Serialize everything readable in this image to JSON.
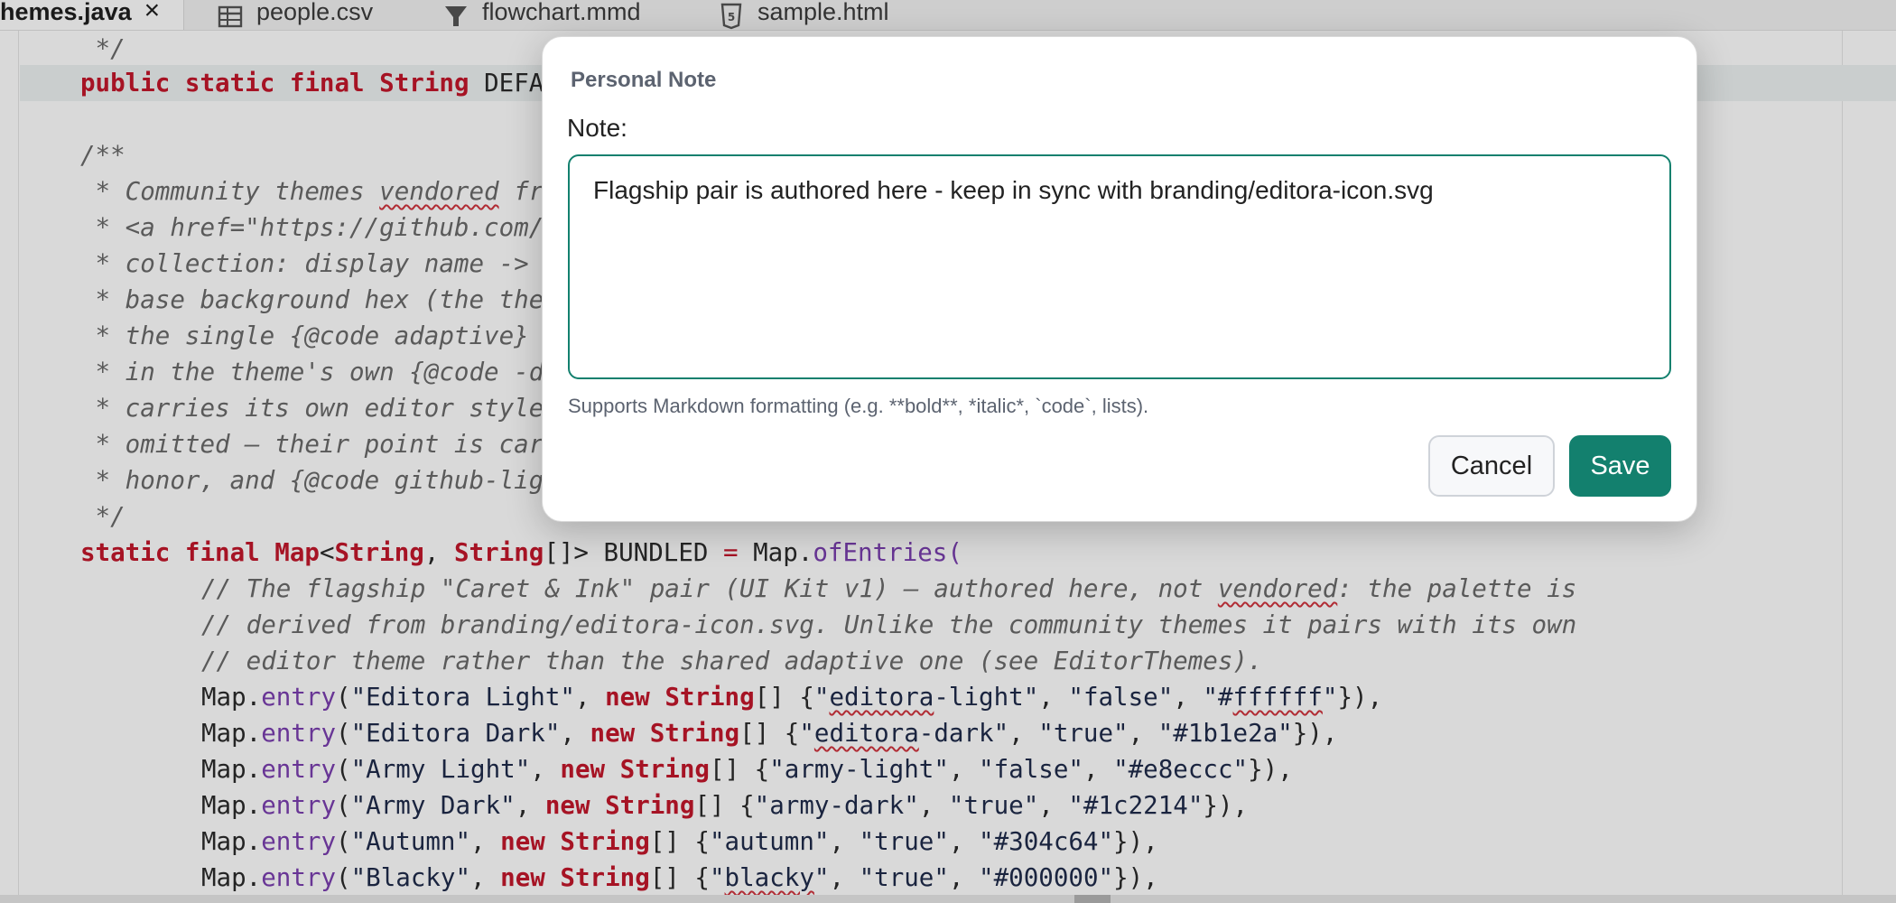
{
  "tabs": [
    {
      "label": "hemes.java",
      "close": "×",
      "active": true,
      "icon": ""
    },
    {
      "label": "people.csv",
      "active": false,
      "icon": "table-icon"
    },
    {
      "label": "flowchart.mmd",
      "active": false,
      "icon": "flowchart-icon"
    },
    {
      "label": "sample.html",
      "active": false,
      "icon": "html5-icon"
    }
  ],
  "code": {
    "line1": " */",
    "line2_a": "public",
    "line2_b": "static",
    "line2_c": "final",
    "line2_d": "String",
    "line2_e": "DEFA",
    "line4": "/**",
    "line5_a": " * Community themes ",
    "line5_b": "vendored",
    "line5_c": " fr",
    "line6": " * <a href=\"https://github.com/",
    "line7": " * collection: display name -> ",
    "line8": " * base background hex (the the",
    "line9": " * the single {@code adaptive} ",
    "line10": " * in the theme's own {@code -d",
    "line11": " * carries its own editor style",
    "line12": " * omitted — their point is car",
    "line13": " * honor, and {@code github-lig",
    "line14": " */",
    "line15_a": "static",
    "line15_b": "final",
    "line15_c": "Map",
    "line15_d": "<",
    "line15_e": "String",
    "line15_f": ", ",
    "line15_g": "String",
    "line15_h": "[]> BUNDLED ",
    "line15_i": "=",
    "line15_j": " Map.",
    "line15_k": "ofEntries",
    "line15_l": "(",
    "line16_a": "// The flagship \"Caret & Ink\" pair (UI Kit v1) — authored here, not ",
    "line16_b": "vendored",
    "line16_c": ": the palette is",
    "line17": "// derived from branding/editora-icon.svg. Unlike the community themes it pairs with its own",
    "line18": "// editor theme rather than the shared adaptive one (see EditorThemes).",
    "entries": [
      {
        "name": "\"Editora Light\"",
        "id_a": "\"",
        "id_b": "editora",
        "id_c": "-light\"",
        "dark": "\"false\"",
        "hex_a": "\"#",
        "hex_b": "ffffff",
        "hex_c": "\"",
        "squig_hex": true
      },
      {
        "name": "\"Editora Dark\"",
        "id_a": "\"",
        "id_b": "editora",
        "id_c": "-dark\"",
        "dark": "\"true\"",
        "hex_a": "\"#1b1e2a\"",
        "hex_b": "",
        "hex_c": "",
        "squig_hex": false
      },
      {
        "name": "\"Army Light\"",
        "id_a": "\"army-light\"",
        "id_b": "",
        "id_c": "",
        "dark": "\"false\"",
        "hex_a": "\"#e8eccc\"",
        "hex_b": "",
        "hex_c": "",
        "squig_hex": false
      },
      {
        "name": "\"Army Dark\"",
        "id_a": "\"army-dark\"",
        "id_b": "",
        "id_c": "",
        "dark": "\"true\"",
        "hex_a": "\"#1c2214\"",
        "hex_b": "",
        "hex_c": "",
        "squig_hex": false
      },
      {
        "name": "\"Autumn\"",
        "id_a": "\"autumn\"",
        "id_b": "",
        "id_c": "",
        "dark": "\"true\"",
        "hex_a": "\"#304c64\"",
        "hex_b": "",
        "hex_c": "",
        "squig_hex": false
      },
      {
        "name": "\"Blacky\"",
        "id_a": "\"",
        "id_b": "blacky",
        "id_c": "\"",
        "dark": "\"true\"",
        "hex_a": "\"#000000\"",
        "hex_b": "",
        "hex_c": "",
        "squig_hex": false
      }
    ],
    "kw_map": "Map.",
    "kw_entry": "entry",
    "kw_new": "new",
    "kw_string": "String",
    "arr": "[] {",
    "sep": ", ",
    "close": "}),"
  },
  "dialog": {
    "title": "Personal Note",
    "label": "Note:",
    "note_value": "Flagship pair is authored here - keep in sync with branding/editora-icon.svg",
    "hint": "Supports Markdown formatting (e.g. **bold**, *italic*, `code`, lists).",
    "cancel_label": "Cancel",
    "save_label": "Save"
  },
  "colors": {
    "accent": "#13806e",
    "keyword": "#c3172b",
    "function": "#7b3fb0"
  }
}
